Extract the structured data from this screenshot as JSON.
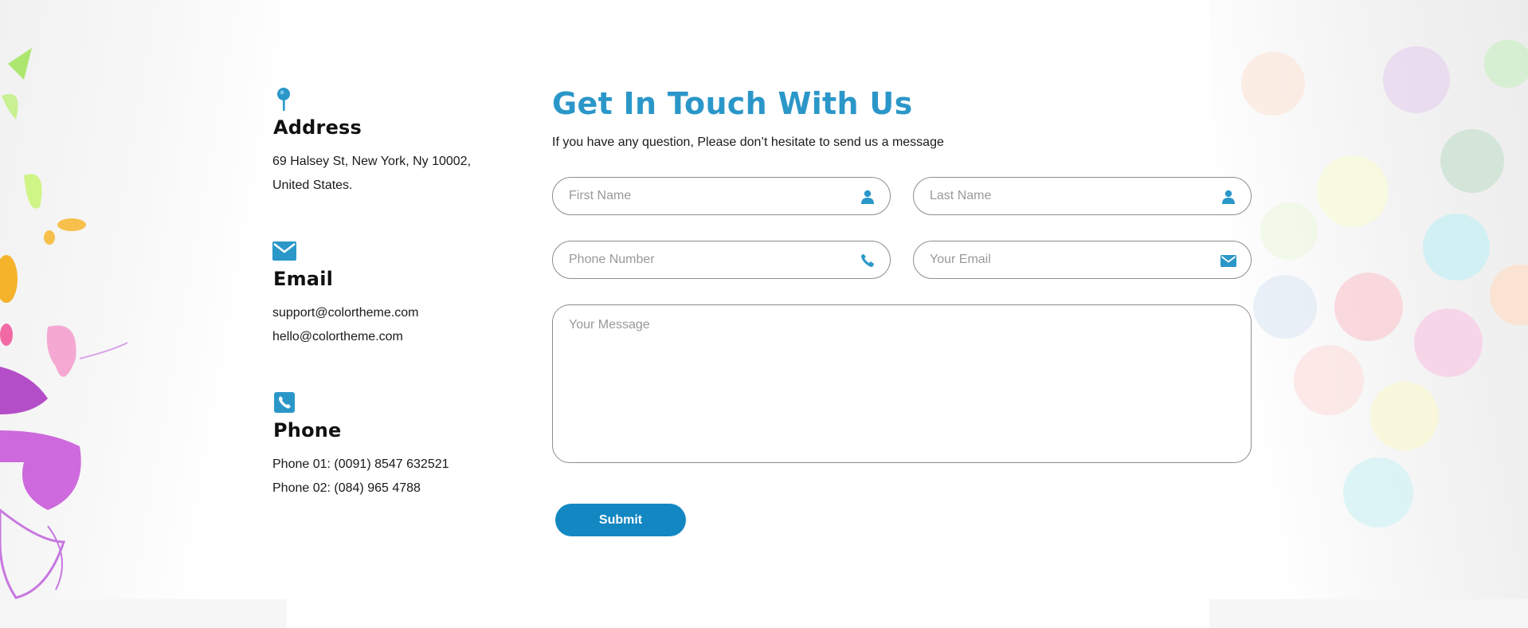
{
  "contact_info": {
    "address": {
      "icon": "map-pin-icon",
      "title": "Address",
      "lines": [
        "69 Halsey St, New York, Ny 10002,",
        "United States."
      ]
    },
    "email": {
      "icon": "envelope-icon",
      "title": "Email",
      "lines": [
        "support@colortheme.com",
        "hello@colortheme.com"
      ]
    },
    "phone": {
      "icon": "phone-icon",
      "title": "Phone",
      "lines": [
        "Phone 01: (0091) 8547 632521",
        "Phone 02: (084) 965 4788"
      ]
    }
  },
  "form": {
    "title": "Get In Touch With Us",
    "subtitle": "If you have any question, Please don’t hesitate to send us a message",
    "fields": {
      "first_name": {
        "placeholder": "First Name",
        "value": "",
        "icon": "user-icon"
      },
      "last_name": {
        "placeholder": "Last Name",
        "value": "",
        "icon": "user-icon"
      },
      "phone": {
        "placeholder": "Phone Number",
        "value": "",
        "icon": "phone-icon"
      },
      "email": {
        "placeholder": "Your Email",
        "value": "",
        "icon": "envelope-icon"
      },
      "message": {
        "placeholder": "Your Message",
        "value": ""
      }
    },
    "submit_label": "Submit"
  },
  "colors": {
    "accent": "#2b97c9",
    "button": "#1287c2",
    "field_border": "#8d8d8d"
  }
}
